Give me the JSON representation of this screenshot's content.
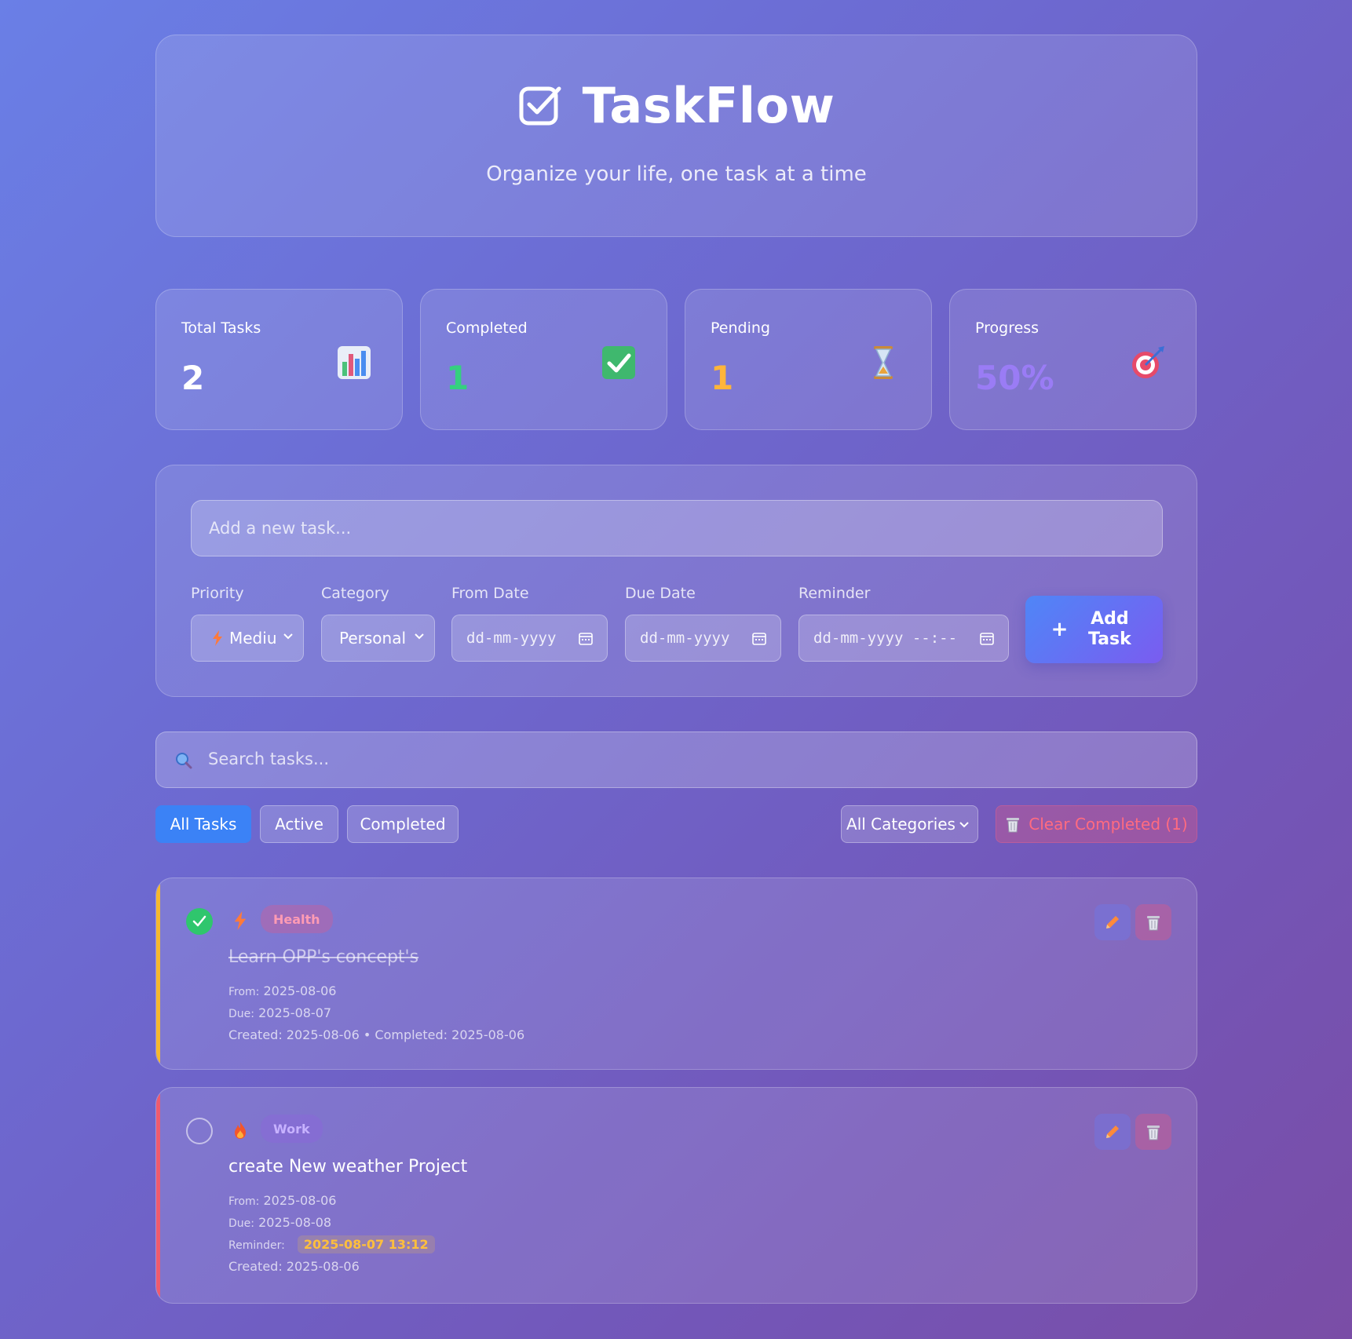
{
  "header": {
    "title": "TaskFlow",
    "subtitle": "Organize your life, one task at a time"
  },
  "stats": [
    {
      "label": "Total Tasks",
      "value": "2",
      "color": "#ffffff",
      "icon": "bar-chart-icon"
    },
    {
      "label": "Completed",
      "value": "1",
      "color": "#35d07f",
      "icon": "check-box-icon"
    },
    {
      "label": "Pending",
      "value": "1",
      "color": "#ffb53a",
      "icon": "hourglass-icon"
    },
    {
      "label": "Progress",
      "value": "50%",
      "color": "#9a7cf5",
      "icon": "target-icon"
    }
  ],
  "add_form": {
    "task_placeholder": "Add a new task...",
    "priority": {
      "label": "Priority",
      "value": "Mediu"
    },
    "category": {
      "label": "Category",
      "value": "Personal"
    },
    "from_date": {
      "label": "From Date",
      "value": "dd-mm-yyyy"
    },
    "due_date": {
      "label": "Due Date",
      "value": "dd-mm-yyyy"
    },
    "reminder": {
      "label": "Reminder",
      "value": "dd-mm-yyyy --:--"
    },
    "add_button": "Add Task"
  },
  "search": {
    "placeholder": "Search tasks..."
  },
  "filters": {
    "all": "All Tasks",
    "active": "Active",
    "completed": "Completed",
    "category_select": "All Categories",
    "clear_completed": "Clear Completed (1)"
  },
  "tasks": [
    {
      "title": "Learn OPP's concept's",
      "category": "Health",
      "completed": true,
      "priority": "medium",
      "border_color": "#f5b82e",
      "from_label": "From:",
      "from": "2025-08-06",
      "due_label": "Due:",
      "due": "2025-08-07",
      "created_line": "Created: 2025-08-06 • Completed: 2025-08-06"
    },
    {
      "title": "create New weather Project",
      "category": "Work",
      "completed": false,
      "priority": "high",
      "border_color": "#ef5b6e",
      "from_label": "From:",
      "from": "2025-08-06",
      "due_label": "Due:",
      "due": "2025-08-08",
      "reminder_label": "Reminder:",
      "reminder": "2025-08-07 13:12",
      "created_line": "Created: 2025-08-06"
    }
  ]
}
